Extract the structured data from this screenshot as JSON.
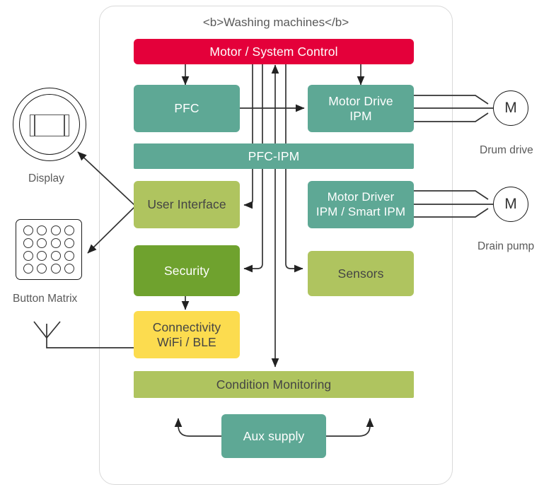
{
  "diagram": {
    "title": "<b>Washing machines</b>",
    "type": "block-diagram",
    "frame": {
      "shape": "rounded-rectangle",
      "border_color": "#d9d9d9"
    },
    "colors": {
      "red": "#E4003A",
      "teal": "#5EA895",
      "olive": "#AFC45F",
      "green": "#6FA22E",
      "yellow": "#FCDC4F",
      "text_dark": "#444444",
      "text_light": "#ffffff",
      "line": "#333333"
    },
    "blocks": [
      {
        "id": "motor-system-control",
        "label": "Motor / System Control",
        "color": "#E4003A",
        "text_color": "#ffffff"
      },
      {
        "id": "pfc",
        "label": "PFC",
        "color": "#5EA895",
        "text_color": "#ffffff"
      },
      {
        "id": "motor-drive-ipm",
        "label": "Motor Drive\nIPM",
        "line1": "Motor Drive",
        "line2": "IPM",
        "color": "#5EA895",
        "text_color": "#ffffff"
      },
      {
        "id": "pfc-ipm",
        "label": "PFC-IPM",
        "color": "#5EA895",
        "text_color": "#ffffff"
      },
      {
        "id": "user-interface",
        "label": "User Interface",
        "color": "#AFC45F",
        "text_color": "#444444"
      },
      {
        "id": "motor-driver-ipm-smart-ipm",
        "label": "Motor Driver\nIPM / Smart IPM",
        "line1": "Motor Driver",
        "line2": "IPM / Smart IPM",
        "color": "#5EA895",
        "text_color": "#ffffff"
      },
      {
        "id": "security",
        "label": "Security",
        "color": "#6FA22E",
        "text_color": "#ffffff"
      },
      {
        "id": "sensors",
        "label": "Sensors",
        "color": "#AFC45F",
        "text_color": "#444444"
      },
      {
        "id": "connectivity",
        "label": "Connectivity\nWiFi / BLE",
        "line1": "Connectivity",
        "line2": "WiFi / BLE",
        "color": "#FCDC4F",
        "text_color": "#444444"
      },
      {
        "id": "condition-monitoring",
        "label": "Condition Monitoring",
        "color": "#AFC45F",
        "text_color": "#444444"
      },
      {
        "id": "aux-supply",
        "label": "Aux supply",
        "color": "#5EA895",
        "text_color": "#ffffff"
      }
    ],
    "peripherals": [
      {
        "id": "display",
        "label": "Display",
        "icon": "round-display-icon"
      },
      {
        "id": "button-matrix",
        "label": "Button Matrix",
        "icon": "button-matrix-icon",
        "rows": 4,
        "cols": 4
      },
      {
        "id": "drum-drive",
        "label": "Drum drive",
        "badge": "M",
        "icon": "motor-icon"
      },
      {
        "id": "drain-pump",
        "label": "Drain pump",
        "badge": "M",
        "icon": "motor-icon"
      },
      {
        "id": "antenna",
        "label": "",
        "icon": "antenna-icon"
      }
    ],
    "connections": [
      {
        "from": "motor-system-control",
        "to": "pfc",
        "arrow": "single"
      },
      {
        "from": "motor-system-control",
        "to": "motor-drive-ipm",
        "arrow": "single"
      },
      {
        "from": "pfc",
        "to": "motor-drive-ipm",
        "arrow": "single"
      },
      {
        "from": "motor-system-control",
        "to": "user-interface",
        "arrow": "single"
      },
      {
        "from": "motor-system-control",
        "to": "security",
        "arrow": "single"
      },
      {
        "from": "motor-system-control",
        "to": "sensors",
        "arrow": "single"
      },
      {
        "from": "sensors",
        "to": "motor-system-control",
        "arrow": "single"
      },
      {
        "from": "motor-system-control",
        "to": "condition-monitoring",
        "arrow": "single"
      },
      {
        "from": "security",
        "to": "connectivity",
        "arrow": "single"
      },
      {
        "from": "user-interface",
        "to": "display",
        "arrow": "single"
      },
      {
        "from": "user-interface",
        "to": "button-matrix",
        "arrow": "single"
      },
      {
        "from": "connectivity",
        "to": "antenna",
        "arrow": "none"
      },
      {
        "from": "motor-drive-ipm",
        "to": "drum-drive",
        "arrow": "none",
        "phases": 3
      },
      {
        "from": "motor-driver-ipm-smart-ipm",
        "to": "drain-pump",
        "arrow": "none",
        "phases": 3
      },
      {
        "from": "aux-supply",
        "to": "left-rail",
        "arrow": "single"
      },
      {
        "from": "aux-supply",
        "to": "right-rail",
        "arrow": "single"
      }
    ]
  }
}
